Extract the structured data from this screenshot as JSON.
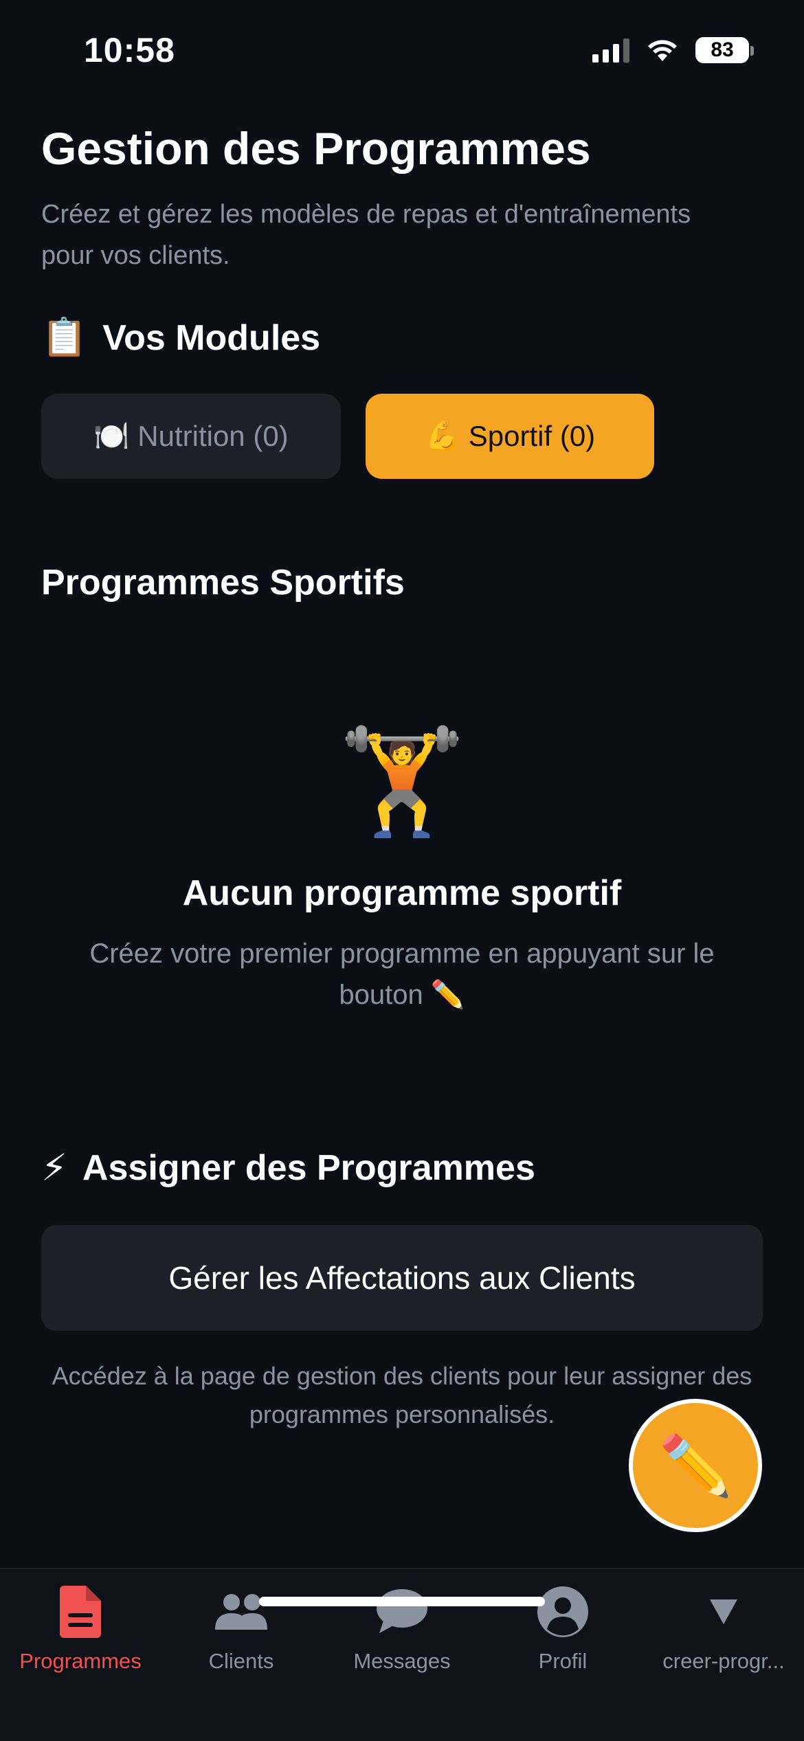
{
  "status_bar": {
    "time": "10:58",
    "battery": "83"
  },
  "header": {
    "title": "Gestion des Programmes",
    "subtitle": "Créez et gérez les modèles de repas et d'entraînements pour vos clients."
  },
  "modules": {
    "icon": "📋",
    "title": "Vos Modules",
    "nutrition_label": "🍽️ Nutrition (0)",
    "sportif_label": "💪 Sportif (0)",
    "active": "sportif"
  },
  "programmes": {
    "title": "Programmes Sportifs",
    "empty_icon": "🏋️",
    "empty_title": "Aucun programme sportif",
    "empty_desc": "Créez votre premier programme en appuyant sur le bouton ✏️"
  },
  "assign": {
    "icon": "⚡",
    "title": "Assigner des Programmes",
    "button_label": "Gérer les Affectations aux Clients",
    "note": "Accédez à la page de gestion des clients pour leur assigner des programmes personnalisés."
  },
  "fab": {
    "icon": "✏️"
  },
  "tab_bar": {
    "tabs": [
      {
        "label": "Programmes",
        "icon": "document-icon",
        "active": true
      },
      {
        "label": "Clients",
        "icon": "users-icon",
        "active": false
      },
      {
        "label": "Messages",
        "icon": "chat-bubble-icon",
        "active": false
      },
      {
        "label": "Profil",
        "icon": "user-circle-icon",
        "active": false
      },
      {
        "label": "creer-progr...",
        "icon": "triangle-down-icon",
        "active": false
      }
    ]
  },
  "colors": {
    "background": "#0b0e14",
    "accent": "#f5a524",
    "active_tab": "#f05252",
    "muted_text": "#8b93a1",
    "card": "#1d2029"
  }
}
